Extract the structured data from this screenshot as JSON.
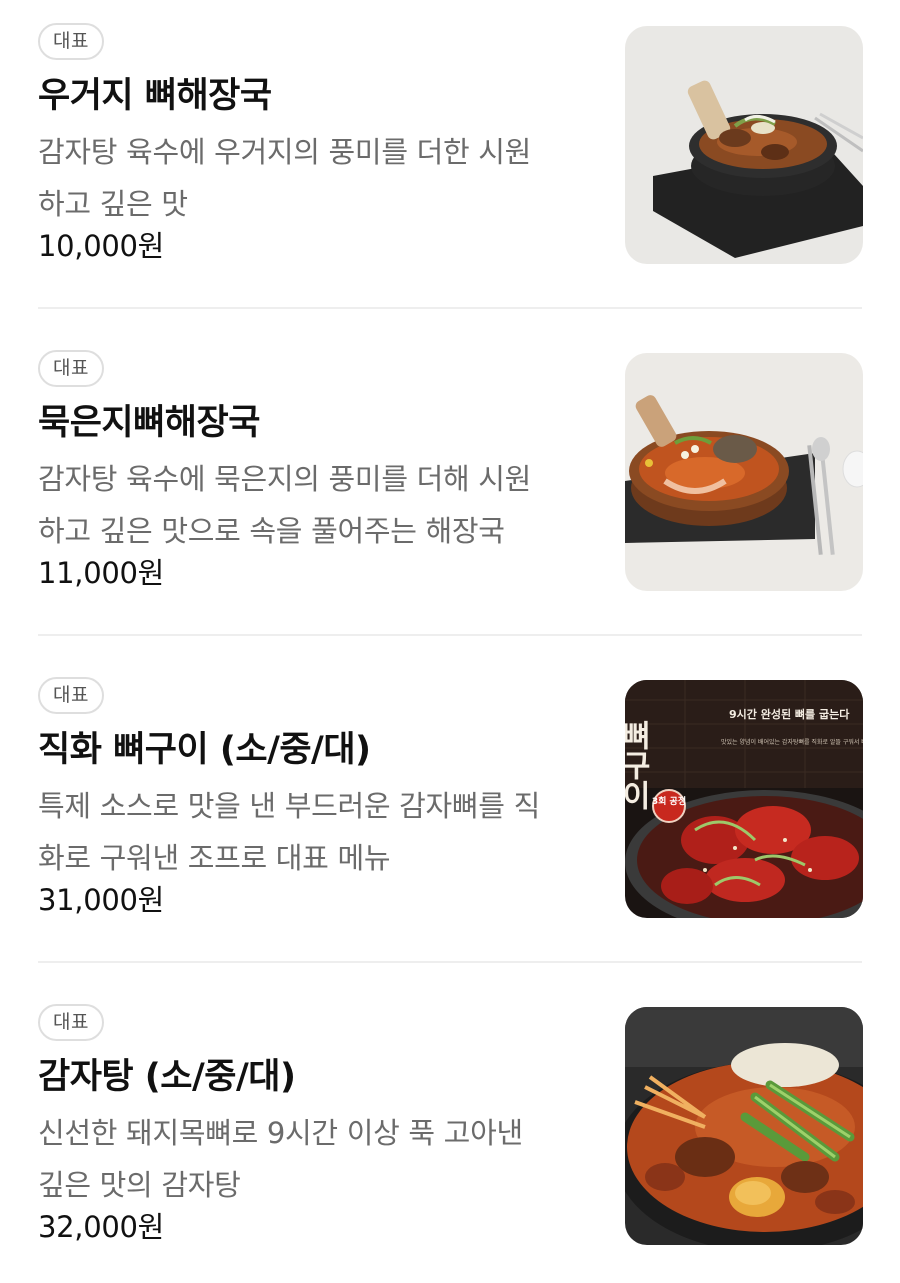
{
  "menu_items": [
    {
      "badge": "대표",
      "name": "우거지 뼈해장국",
      "description_lines": [
        "감자탕 육수에 우거지의 풍미를 더한 시원",
        "하고 깊은 맛"
      ],
      "price": "10,000원"
    },
    {
      "badge": "대표",
      "name": "묵은지뼈해장국",
      "description_lines": [
        "감자탕 육수에 묵은지의 풍미를 더해 시원",
        "하고 깊은 맛으로 속을 풀어주는 해장국"
      ],
      "price": "11,000원"
    },
    {
      "badge": "대표",
      "name": "직화 뼈구이 (소/중/대)",
      "description_lines": [
        "특제 소스로 맛을 낸 부드러운 감자뼈를 직",
        "화로 구워낸 조프로 대표 메뉴"
      ],
      "price": "31,000원",
      "image_text": {
        "side_title": "뼈구이",
        "headline": "9시간 완성된 뼈를 굽는다",
        "body": "맛있는 양념이 배어있는 감자탕뼈를 직화로 알뜰 구워서 뼈소스를 풀어낸 조프로 특화 메뉴",
        "stamp": "3회 공정"
      }
    },
    {
      "badge": "대표",
      "name": "감자탕 (소/중/대)",
      "description_lines": [
        "신선한 돼지목뼈로 9시간 이상 푹 고아낸",
        "깊은 맛의 감자탕"
      ],
      "price": "32,000원"
    }
  ]
}
